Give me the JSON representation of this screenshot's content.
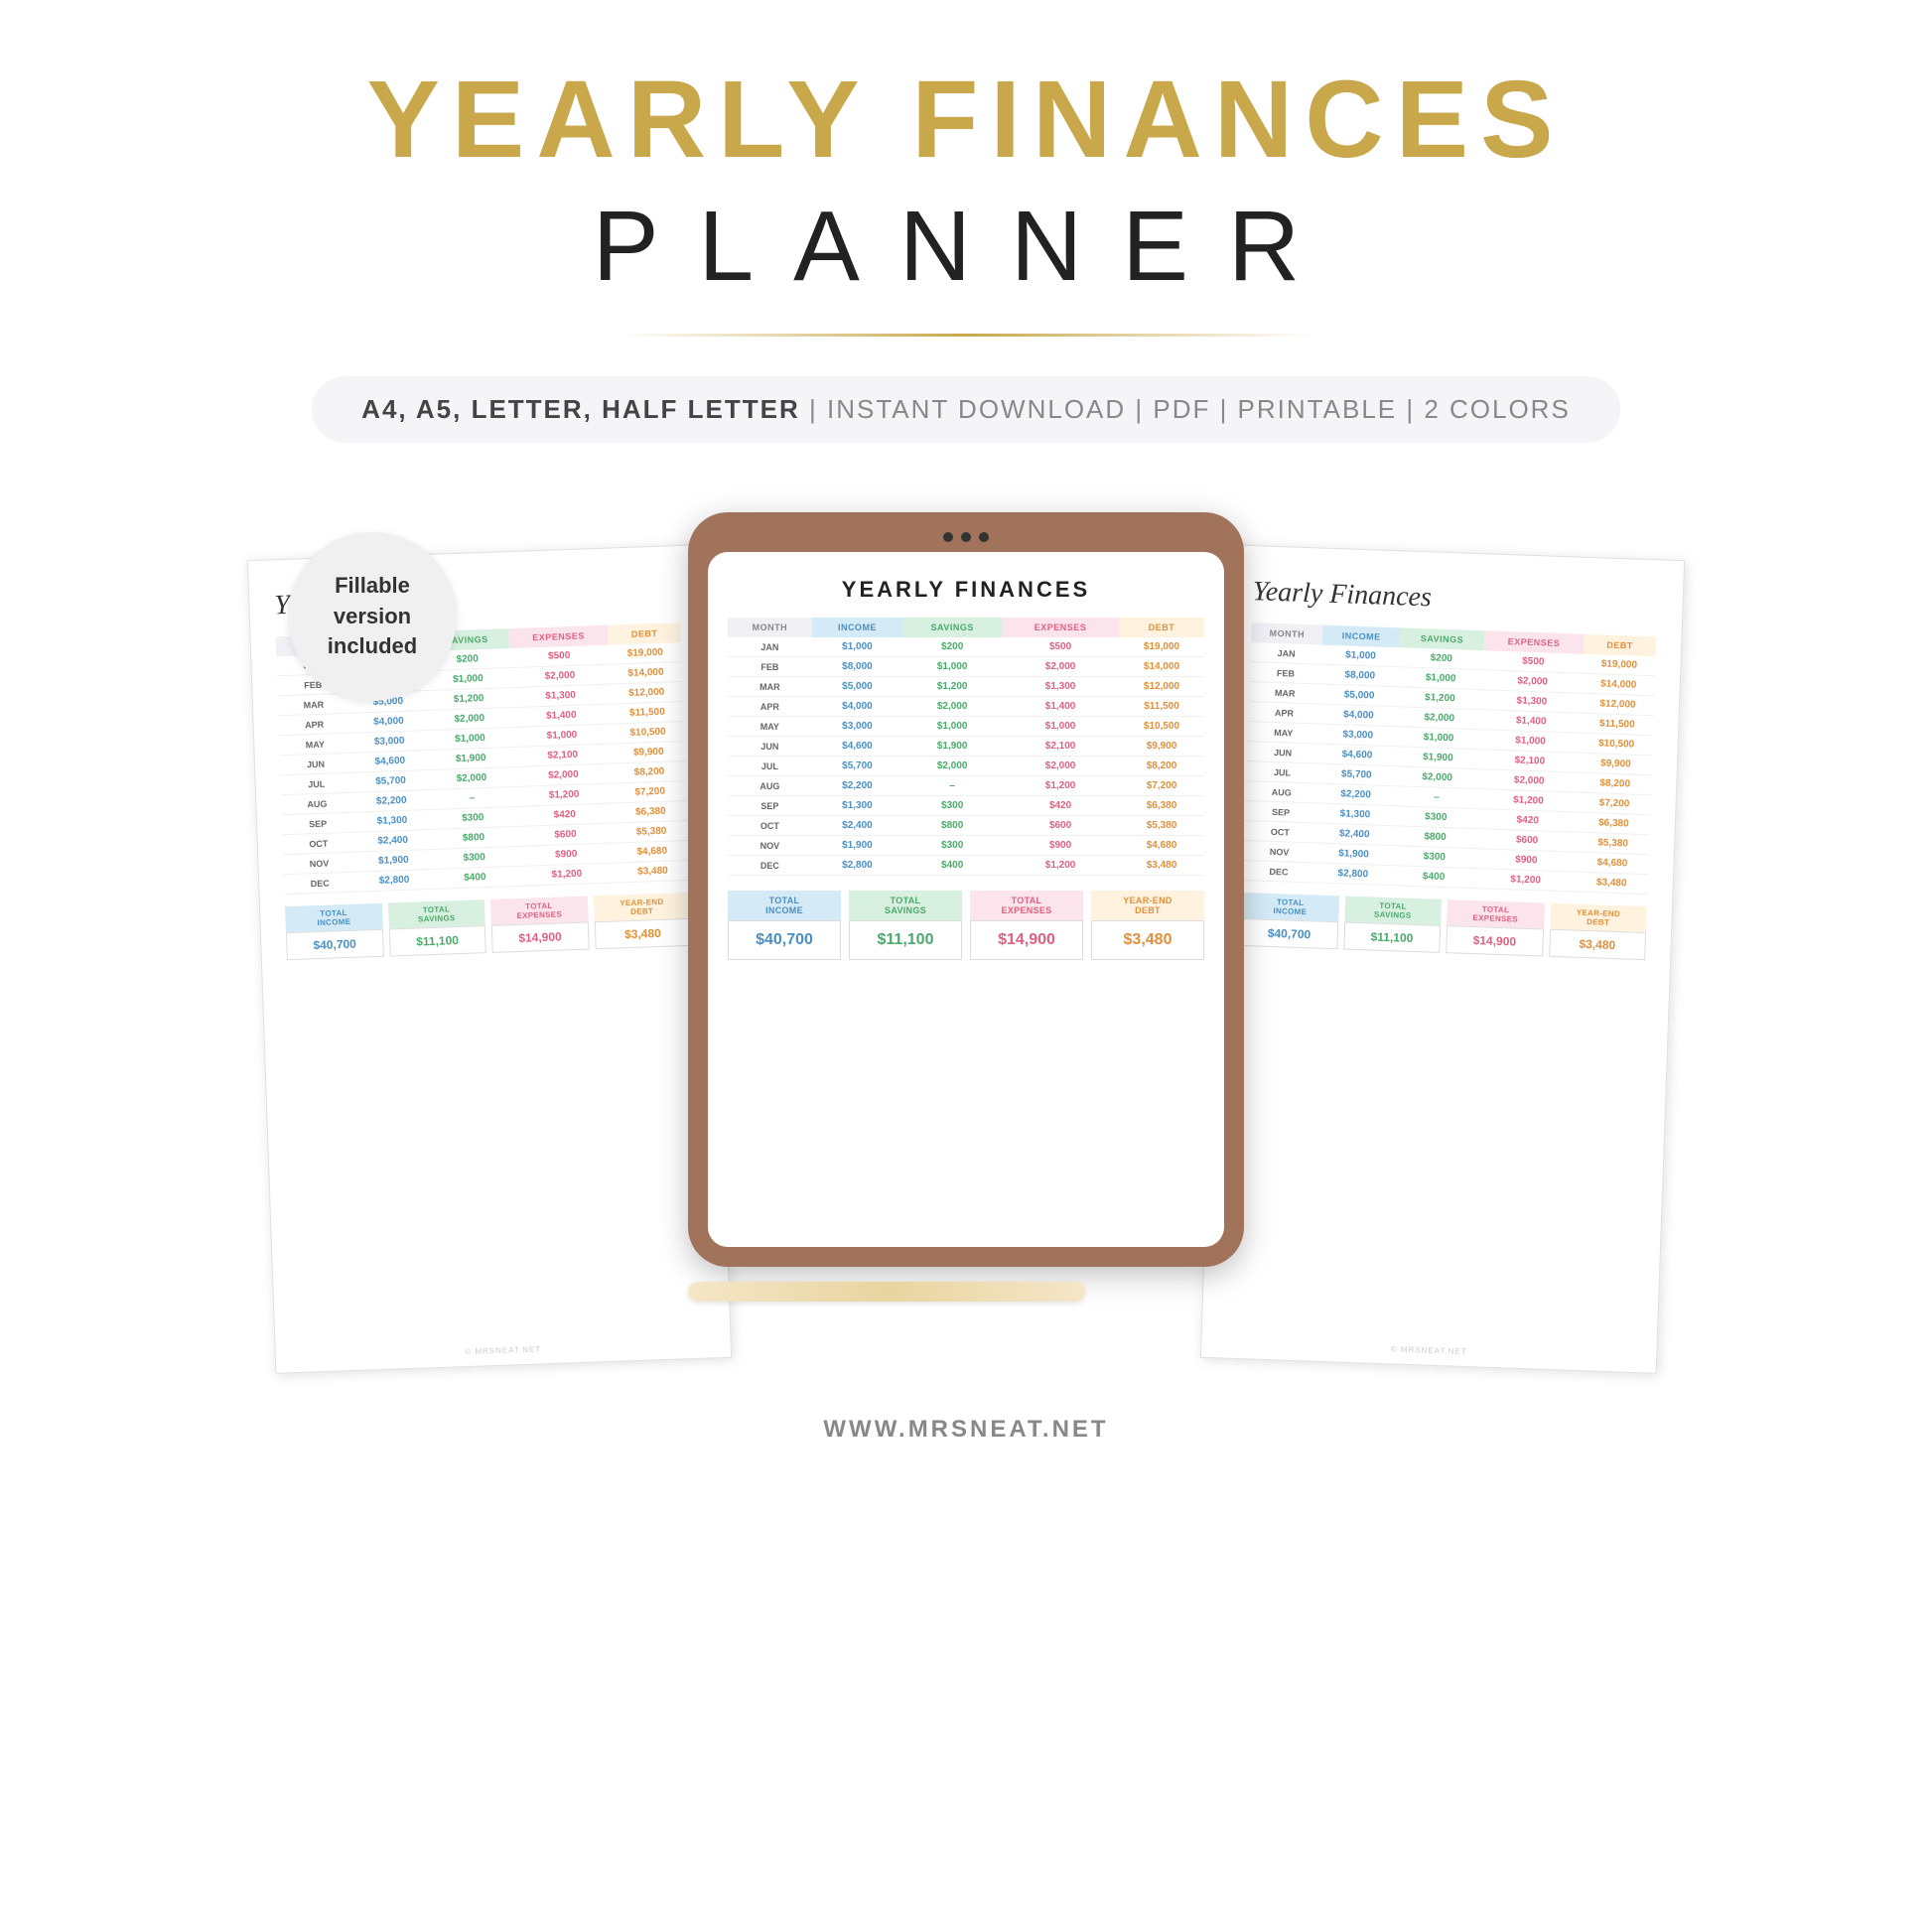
{
  "header": {
    "line1": "YEARLY FINANCES",
    "line2": "PLANNER",
    "subtitle": "A4, A5, LETTER, HALF LETTER",
    "subtitle_extra": "| INSTANT DOWNLOAD | PDF | PRINTABLE | 2 COLORS"
  },
  "fillable_badge": {
    "line1": "Fillable",
    "line2": "version",
    "line3": "included"
  },
  "sheet_title": "Yearly Finances",
  "tablet_title": "YEARLY FINANCES",
  "columns": {
    "month": "MONTH",
    "income": "INCOME",
    "savings": "SAVINGS",
    "expenses": "EXPENSES",
    "debt": "DEBT"
  },
  "rows": [
    {
      "month": "JAN",
      "income": "$1,000",
      "savings": "$200",
      "expenses": "$500",
      "debt": "$19,000"
    },
    {
      "month": "FEB",
      "income": "$8,000",
      "savings": "$1,000",
      "expenses": "$2,000",
      "debt": "$14,000"
    },
    {
      "month": "MAR",
      "income": "$5,000",
      "savings": "$1,200",
      "expenses": "$1,300",
      "debt": "$12,000"
    },
    {
      "month": "APR",
      "income": "$4,000",
      "savings": "$2,000",
      "expenses": "$1,400",
      "debt": "$11,500"
    },
    {
      "month": "MAY",
      "income": "$3,000",
      "savings": "$1,000",
      "expenses": "$1,000",
      "debt": "$10,500"
    },
    {
      "month": "JUN",
      "income": "$4,600",
      "savings": "$1,900",
      "expenses": "$2,100",
      "debt": "$9,900"
    },
    {
      "month": "JUL",
      "income": "$5,700",
      "savings": "$2,000",
      "expenses": "$2,000",
      "debt": "$8,200"
    },
    {
      "month": "AUG",
      "income": "$2,200",
      "savings": "–",
      "expenses": "$1,200",
      "debt": "$7,200"
    },
    {
      "month": "SEP",
      "income": "$1,300",
      "savings": "$300",
      "expenses": "$420",
      "debt": "$6,380"
    },
    {
      "month": "OCT",
      "income": "$2,400",
      "savings": "$800",
      "expenses": "$600",
      "debt": "$5,380"
    },
    {
      "month": "NOV",
      "income": "$1,900",
      "savings": "$300",
      "expenses": "$900",
      "debt": "$4,680"
    },
    {
      "month": "DEC",
      "income": "$2,800",
      "savings": "$400",
      "expenses": "$1,200",
      "debt": "$3,480"
    }
  ],
  "totals": {
    "income_label": "TOTAL\nINCOME",
    "savings_label": "TOTAL\nSAVINGS",
    "expenses_label": "TOTAL\nEXPENSES",
    "debt_label": "YEAR-END\nDEBT",
    "income_value": "$40,700",
    "savings_value": "$11,100",
    "expenses_value": "$14,900",
    "debt_value": "$3,480"
  },
  "footer": {
    "url": "WWW.MRSNEAT.NET",
    "watermark": "© MRSNEAT.NET"
  }
}
